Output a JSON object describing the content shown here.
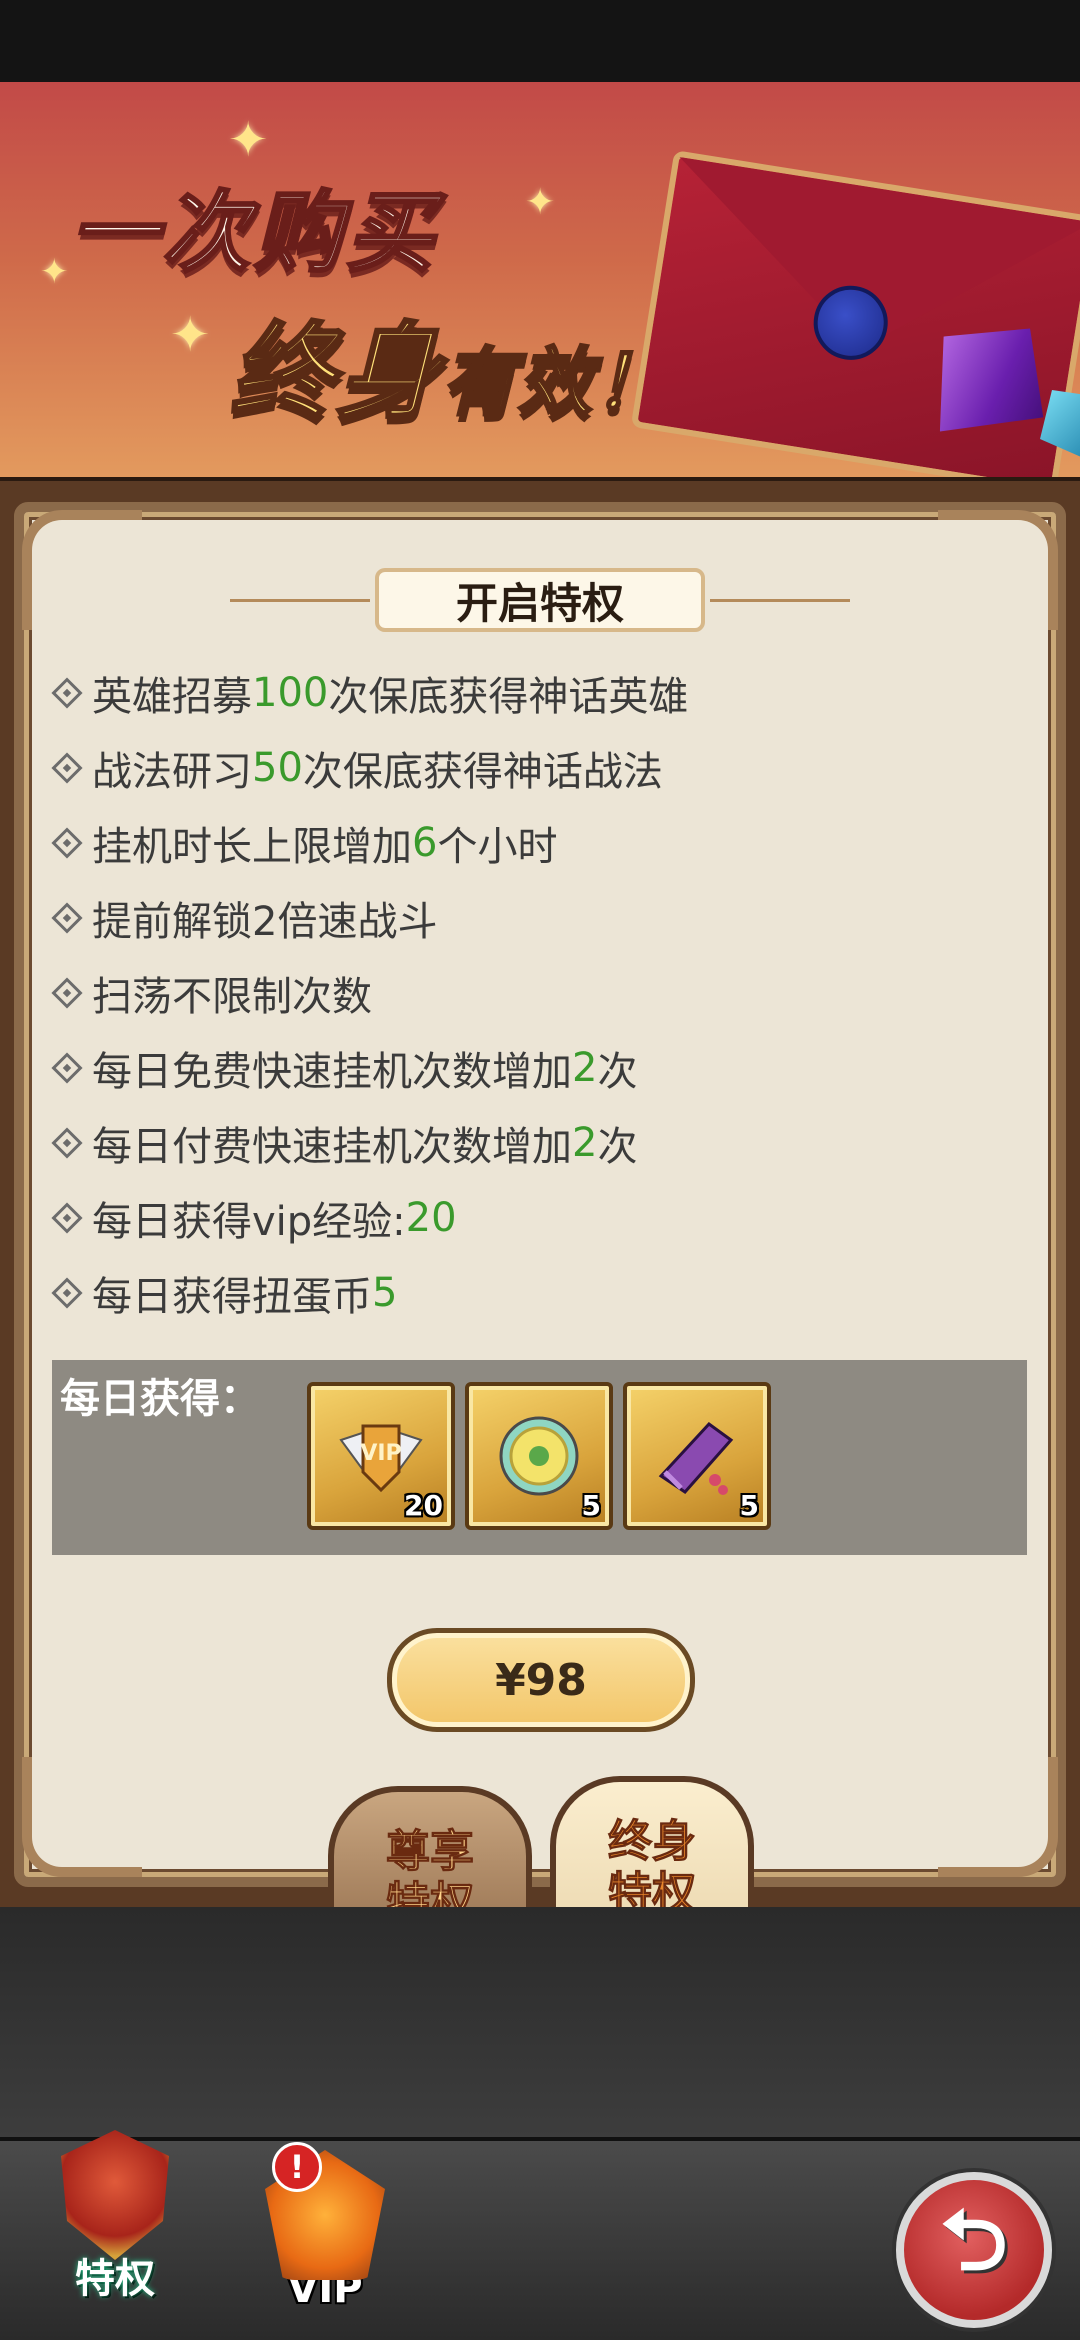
{
  "banner": {
    "line1": "一次购买",
    "line2_big": "终身",
    "line2_small": "有效！"
  },
  "panel": {
    "title": "开启特权",
    "perks": [
      {
        "pre": "英雄招募",
        "hl": "100",
        "post": "次保底获得神话英雄"
      },
      {
        "pre": "战法研习",
        "hl": "50",
        "post": "次保底获得神话战法"
      },
      {
        "pre": "挂机时长上限增加",
        "hl": "6",
        "post": "个小时"
      },
      {
        "pre": "提前解锁2倍速战斗",
        "hl": "",
        "post": ""
      },
      {
        "pre": "扫荡不限制次数",
        "hl": "",
        "post": ""
      },
      {
        "pre": "每日免费快速挂机次数增加",
        "hl": "2",
        "post": "次"
      },
      {
        "pre": "每日付费快速挂机次数增加",
        "hl": "2",
        "post": "次"
      },
      {
        "pre": "每日获得vip经验:",
        "hl": "20",
        "post": ""
      },
      {
        "pre": "每日获得扭蛋币 ",
        "hl": "5",
        "post": ""
      }
    ],
    "daily": {
      "label": "每日获得：",
      "items": [
        {
          "icon": "vip-badge-icon",
          "count": "20"
        },
        {
          "icon": "gacha-coin-icon",
          "count": "5"
        },
        {
          "icon": "purple-scroll-icon",
          "count": "5"
        }
      ]
    },
    "price": "¥98"
  },
  "tabs": [
    {
      "line1": "尊享",
      "line2": "特权"
    },
    {
      "line1": "终身",
      "line2": "特权"
    }
  ],
  "nav": {
    "privilege_label": "特权",
    "vip_label": "VIP",
    "alert": "!",
    "back_icon": "back-arrow-icon"
  },
  "colors": {
    "highlight": "#3a9a2c",
    "banner_top": "#c24a48",
    "panel_bg": "#ece5d6"
  }
}
